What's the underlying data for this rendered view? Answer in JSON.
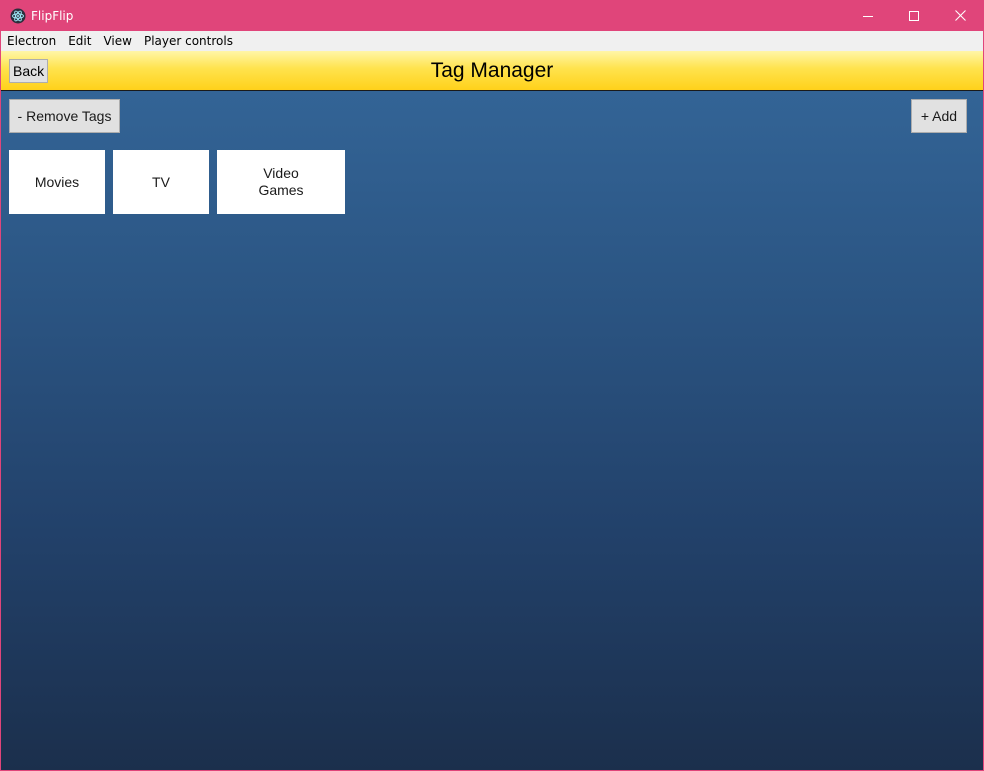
{
  "window": {
    "title": "FlipFlip",
    "controls": [
      "minimize-icon",
      "maximize-icon",
      "close-icon"
    ],
    "accent_color": "#e0457a"
  },
  "menu": {
    "items": [
      {
        "label": "Electron"
      },
      {
        "label": "Edit"
      },
      {
        "label": "View"
      },
      {
        "label": "Player controls"
      }
    ]
  },
  "header": {
    "back_label": "Back",
    "title": "Tag Manager",
    "color": "#ffd11a"
  },
  "toolbar": {
    "remove_label": "- Remove Tags",
    "add_label": "+ Add"
  },
  "tags": [
    {
      "lines": [
        "Movies"
      ]
    },
    {
      "lines": [
        "TV"
      ]
    },
    {
      "lines": [
        "Video",
        "Games"
      ]
    }
  ]
}
